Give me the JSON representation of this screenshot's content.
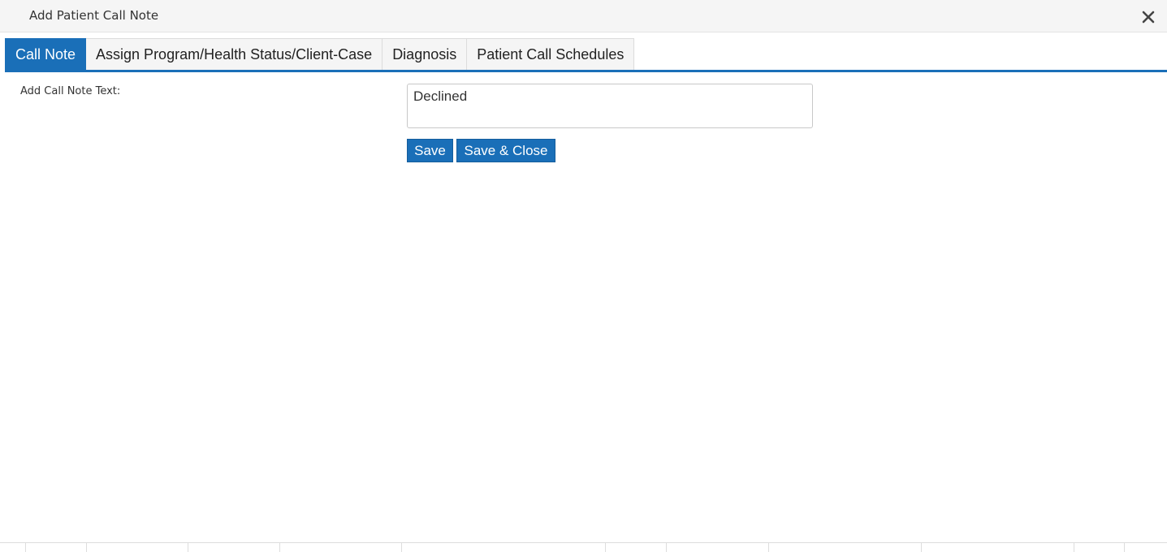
{
  "dialog": {
    "title": "Add Patient Call Note",
    "close_icon": "close-icon"
  },
  "tabs": [
    {
      "label": "Call Note",
      "active": true
    },
    {
      "label": "Assign Program/Health Status/Client-Case",
      "active": false
    },
    {
      "label": "Diagnosis",
      "active": false
    },
    {
      "label": "Patient Call Schedules",
      "active": false
    }
  ],
  "form": {
    "note_label": "Add Call Note Text:",
    "note_value": "Declined"
  },
  "buttons": {
    "save_label": "Save",
    "save_close_label": "Save & Close"
  },
  "colors": {
    "accent": "#1a6fb8",
    "titlebar_bg": "#f5f5f5"
  }
}
